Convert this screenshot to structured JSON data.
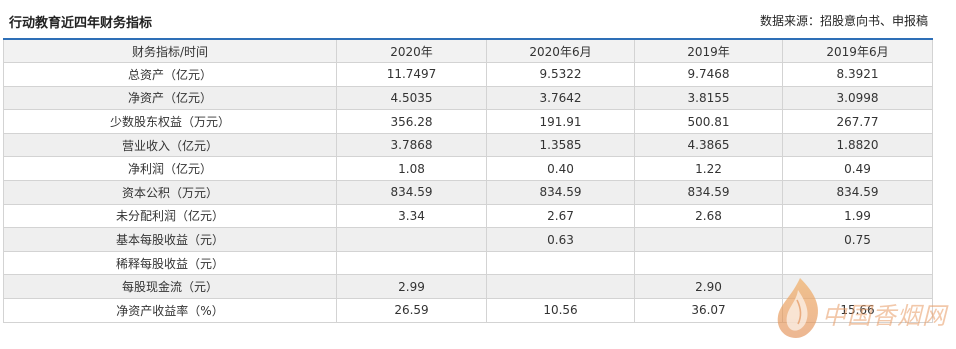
{
  "header": {
    "title": "行动教育近四年财务指标",
    "source": "数据来源：招股意向书、申报稿"
  },
  "table": {
    "columns": [
      "财务指标/时间",
      "2020年",
      "2020年6月",
      "2019年",
      "2019年6月"
    ],
    "rows": [
      [
        "总资产（亿元）",
        "11.7497",
        "9.5322",
        "9.7468",
        "8.3921"
      ],
      [
        "净资产（亿元）",
        "4.5035",
        "3.7642",
        "3.8155",
        "3.0998"
      ],
      [
        "少数股东权益（万元）",
        "356.28",
        "191.91",
        "500.81",
        "267.77"
      ],
      [
        "营业收入（亿元）",
        "3.7868",
        "1.3585",
        "4.3865",
        "1.8820"
      ],
      [
        "净利润（亿元）",
        "1.08",
        "0.40",
        "1.22",
        "0.49"
      ],
      [
        "资本公积（万元）",
        "834.59",
        "834.59",
        "834.59",
        "834.59"
      ],
      [
        "未分配利润（亿元）",
        "3.34",
        "2.67",
        "2.68",
        "1.99"
      ],
      [
        "基本每股收益（元）",
        "",
        "0.63",
        "",
        "0.75"
      ],
      [
        "稀释每股收益（元）",
        "",
        "",
        "",
        ""
      ],
      [
        "每股现金流（元）",
        "2.99",
        "",
        "2.90",
        ""
      ],
      [
        "净资产收益率（%）",
        "26.59",
        "10.56",
        "36.07",
        "15.66"
      ]
    ]
  },
  "watermark": {
    "text": "中国香烟网",
    "color": "#e89b64",
    "icon": "flame-leaf-icon"
  },
  "colors": {
    "header_rule": "#2e6fb7",
    "row_alt": "#efefef",
    "border": "#d3d3d3"
  }
}
